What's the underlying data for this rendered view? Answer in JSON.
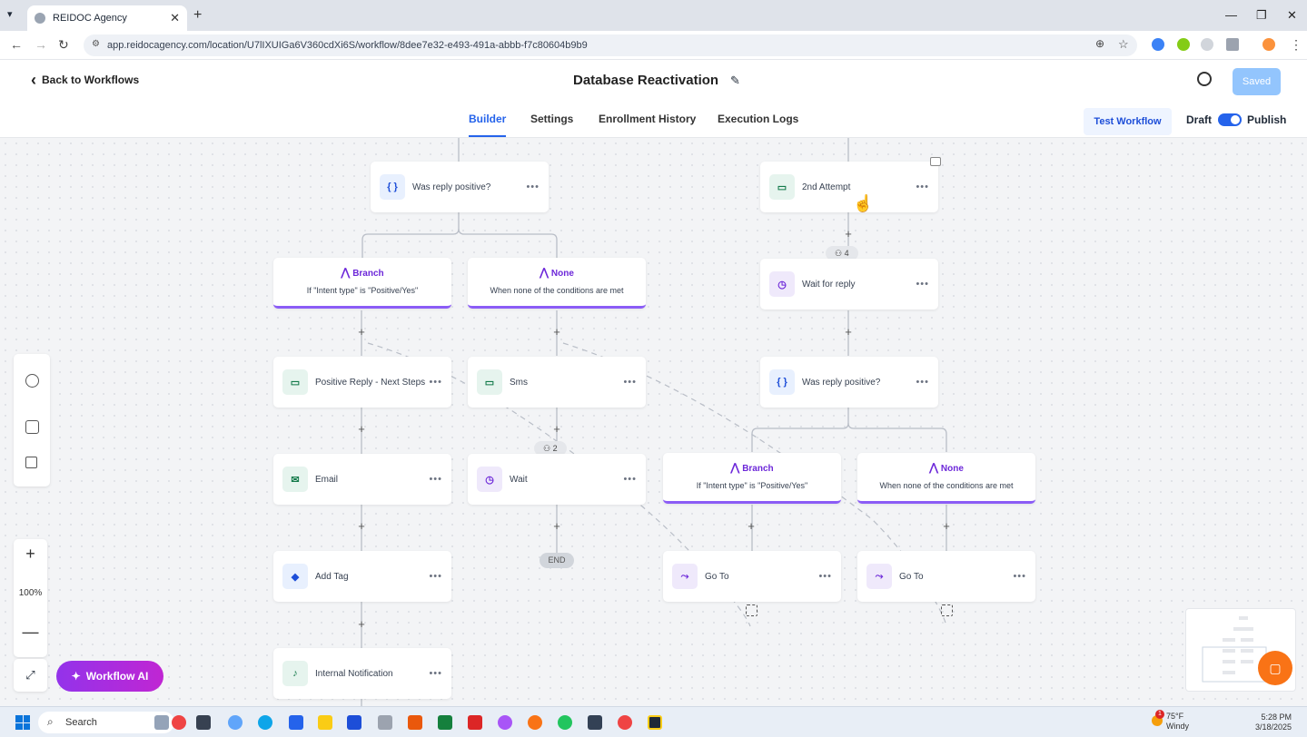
{
  "browser": {
    "tab_title": "REIDOC Agency",
    "url": "app.reidocagency.com/location/U7lIXUIGa6V360cdXi6S/workflow/8dee7e32-e493-491a-abbb-f7c80604b9b9"
  },
  "header": {
    "back_label": "Back to Workflows",
    "workflow_title": "Database Reactivation",
    "saved_label": "Saved"
  },
  "nav": {
    "tabs": [
      "Builder",
      "Settings",
      "Enrollment History",
      "Execution Logs"
    ],
    "active_tab": "Builder",
    "test_workflow": "Test Workflow",
    "draft": "Draft",
    "publish": "Publish",
    "published": true
  },
  "canvas": {
    "nodes": {
      "was_reply_positive_1": "Was reply positive?",
      "branch_1": "Branch",
      "branch_1_desc": "If \"Intent type\" is \"Positive/Yes\"",
      "none_1": "None",
      "none_1_desc": "When none of the conditions are met",
      "positive_reply": "Positive Reply - Next Steps",
      "sms": "Sms",
      "email": "Email",
      "wait": "Wait",
      "add_tag": "Add Tag",
      "internal_notification": "Internal Notification",
      "end": "END",
      "second_attempt": "2nd Attempt",
      "wait_for_reply": "Wait for reply",
      "was_reply_positive_2": "Was reply positive?",
      "branch_2": "Branch",
      "branch_2_desc": "If \"Intent type\" is \"Positive/Yes\"",
      "none_2": "None",
      "none_2_desc": "When none of the conditions are met",
      "goto_1": "Go To",
      "goto_2": "Go To"
    },
    "badges": {
      "contacts_wait": "2",
      "contacts_wait_reply": "4"
    },
    "zoom": "100%",
    "workflow_ai": "Workflow AI"
  },
  "taskbar": {
    "search": "Search",
    "weather_temp": "75°F",
    "weather_desc": "Windy",
    "weather_alert_count": "1",
    "time": "5:28 PM",
    "date": "3/18/2025"
  },
  "colors": {
    "accent": "#2563eb",
    "branch": "#8b5cf6",
    "action_green": "#137a4a",
    "ai_gradient": "#9333ea"
  }
}
